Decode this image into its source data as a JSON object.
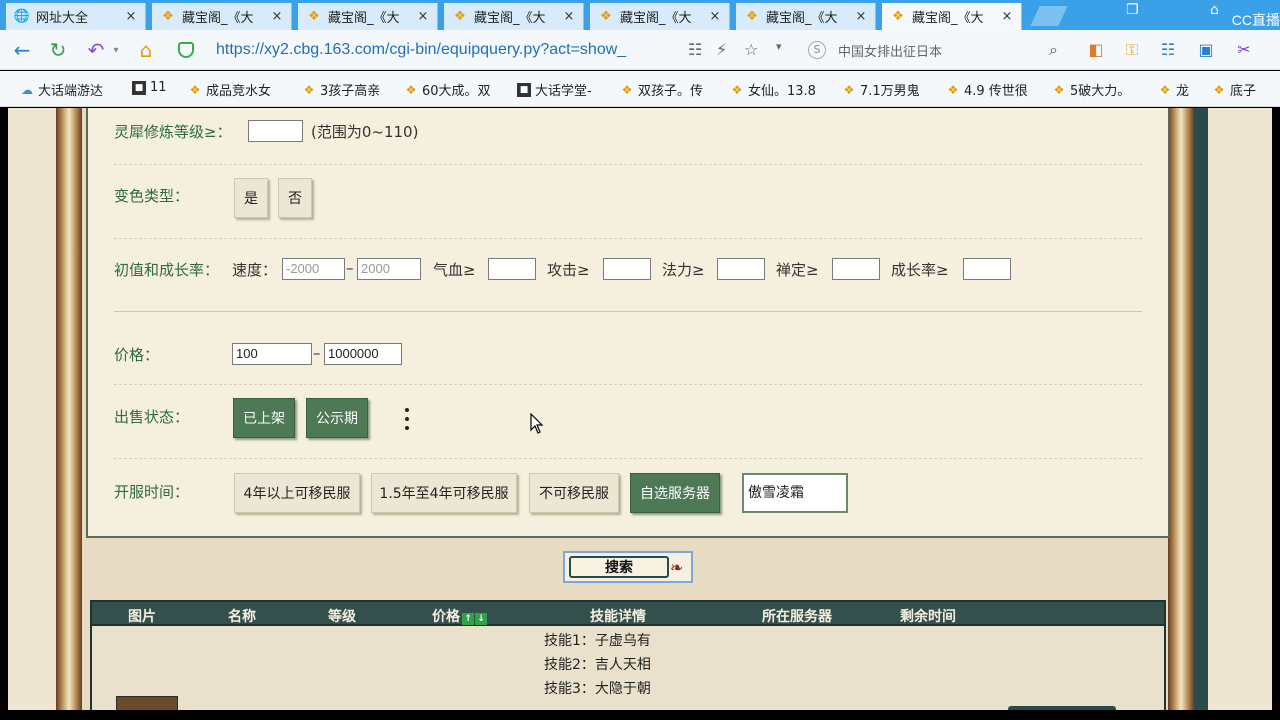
{
  "tabs": [
    {
      "title": "网址大全",
      "icon": "globe-icon"
    },
    {
      "title": "藏宝阁_《大",
      "icon": "treasure-icon"
    },
    {
      "title": "藏宝阁_《大",
      "icon": "treasure-icon"
    },
    {
      "title": "藏宝阁_《大",
      "icon": "treasure-icon"
    },
    {
      "title": "藏宝阁_《大",
      "icon": "treasure-icon"
    },
    {
      "title": "藏宝阁_《大",
      "icon": "treasure-icon"
    },
    {
      "title": "藏宝阁_《大",
      "icon": "treasure-icon"
    }
  ],
  "tab_close": "×",
  "brand": "CC直播",
  "address": {
    "url": "https://xy2.cbg.163.com/cgi-bin/equipquery.py?act=show_",
    "search_placeholder": "中国女排出征日本"
  },
  "bookmarks": [
    {
      "label": "大话端游达",
      "icon": "cloud-icon"
    },
    {
      "label": "11",
      "icon": "dark-tile-icon"
    },
    {
      "label": "成品竞水女",
      "icon": "treasure-icon"
    },
    {
      "label": "3孩子高亲",
      "icon": "treasure-icon"
    },
    {
      "label": "60大成。双",
      "icon": "treasure-icon"
    },
    {
      "label": "大话学堂-",
      "icon": "dark-tile-icon"
    },
    {
      "label": "双孩子。传",
      "icon": "treasure-icon"
    },
    {
      "label": "女仙。13.8",
      "icon": "treasure-icon"
    },
    {
      "label": "7.1万男鬼",
      "icon": "treasure-icon"
    },
    {
      "label": "4.9 传世很",
      "icon": "treasure-icon"
    },
    {
      "label": "5破大力。",
      "icon": "treasure-icon"
    },
    {
      "label": "龙",
      "icon": "treasure-icon"
    },
    {
      "label": "底子",
      "icon": "treasure-icon"
    }
  ],
  "form": {
    "lingxi_label": "灵犀修炼等级≥：",
    "lingxi_range": "(范围为0~110)",
    "color_label": "变色类型：",
    "color_yes": "是",
    "color_no": "否",
    "growth_label": "初值和成长率：",
    "speed_label": "速度：",
    "speed_min_placeholder": "-2000",
    "speed_dash": "–",
    "speed_max_placeholder": "2000",
    "hp_label": "气血≥",
    "atk_label": "攻击≥",
    "mp_label": "法力≥",
    "zen_label": "禅定≥",
    "growth_rate_label": "成长率≥",
    "price_label": "价格：",
    "price_min": "100",
    "price_dash": "–",
    "price_max": "1000000",
    "sale_label": "出售状态：",
    "sale_listed": "已上架",
    "sale_public": "公示期",
    "server_label": "开服时间：",
    "server_4y": "4年以上可移民服",
    "server_15_4y": "1.5年至4年可移民服",
    "server_nomove": "不可移民服",
    "server_custom": "自选服务器",
    "server_value": "傲雪凌霜"
  },
  "search_button": "搜索",
  "results": {
    "headers": [
      "图片",
      "名称",
      "等级",
      "价格",
      "技能详情",
      "所在服务器",
      "剩余时间"
    ],
    "sort_up": "↑",
    "sort_down": "↓",
    "skills": [
      "技能1：子虚乌有",
      "技能2：吉人天相",
      "技能3：大隐于朝"
    ]
  }
}
